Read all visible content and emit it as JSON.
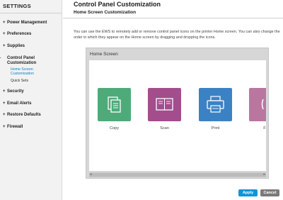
{
  "sidebar": {
    "title": "SETTINGS",
    "items": [
      {
        "label": "Power Management",
        "marker": "+"
      },
      {
        "label": "Preferences",
        "marker": "+"
      },
      {
        "label": "Supplies",
        "marker": "+"
      },
      {
        "label": "Control Panel Customization",
        "marker": "–"
      },
      {
        "label": "Security",
        "marker": "+"
      },
      {
        "label": "Email Alerts",
        "marker": "+"
      },
      {
        "label": "Restore Defaults",
        "marker": "+"
      },
      {
        "label": "Firewall",
        "marker": "+"
      }
    ],
    "sub_items": [
      {
        "label": "Home Screen Customization",
        "active": true
      },
      {
        "label": "Quick Sets",
        "active": false
      }
    ]
  },
  "header": {
    "title": "Control Panel Customization",
    "subtitle": "Home Screen Customization"
  },
  "description": "You can use the EWS to remotely add or remove control panel icons on the printer Home screen. You can also change the order in which they appear on the Home screen by dragging and dropping the icons.",
  "home_screen": {
    "title": "Home Screen",
    "tiles": [
      {
        "label": "Copy",
        "icon": "copy-icon",
        "color": "#4faa7a"
      },
      {
        "label": "Scan",
        "icon": "scan-icon",
        "color": "#a34d8d"
      },
      {
        "label": "Print",
        "icon": "print-icon",
        "color": "#3b82c4"
      },
      {
        "label": "Fa",
        "icon": "fax-icon",
        "color": "#b9779f"
      }
    ]
  },
  "buttons": {
    "apply": "Apply",
    "cancel": "Cancel"
  },
  "colors": {
    "accent": "#0b96d6",
    "active_link": "#0b7fc4"
  }
}
